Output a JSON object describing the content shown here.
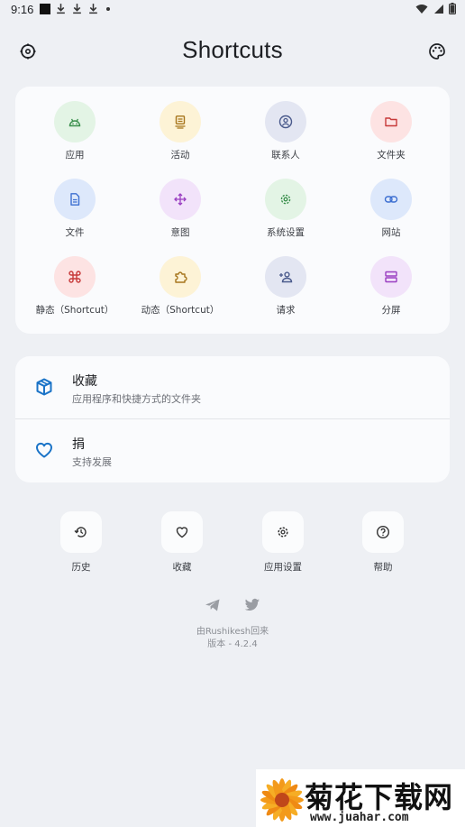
{
  "status_bar": {
    "time": "9:16"
  },
  "header": {
    "title": "Shortcuts"
  },
  "grid": [
    {
      "label": "应用",
      "icon": "android-icon",
      "bg": "#e3f4e5",
      "fg": "#3a8f4c"
    },
    {
      "label": "活动",
      "icon": "activity-icon",
      "bg": "#fdf3d6",
      "fg": "#a6741b"
    },
    {
      "label": "联系人",
      "icon": "contact-icon",
      "bg": "#e3e6f2",
      "fg": "#4a5a8c"
    },
    {
      "label": "文件夹",
      "icon": "folder-icon",
      "bg": "#fde3e3",
      "fg": "#c73a3a"
    },
    {
      "label": "文件",
      "icon": "file-icon",
      "bg": "#dde8fb",
      "fg": "#3d6fd1"
    },
    {
      "label": "意图",
      "icon": "intent-icon",
      "bg": "#f2e3fa",
      "fg": "#9a3ec1"
    },
    {
      "label": "系统设置",
      "icon": "settings-icon",
      "bg": "#e3f4e5",
      "fg": "#3a8f4c"
    },
    {
      "label": "网站",
      "icon": "link-icon",
      "bg": "#dde8fb",
      "fg": "#3d6fd1"
    },
    {
      "label": "静态（Shortcut）",
      "icon": "command-icon",
      "bg": "#fde3e3",
      "fg": "#c73a3a"
    },
    {
      "label": "动态（Shortcut）",
      "icon": "puzzle-icon",
      "bg": "#fdf3d6",
      "fg": "#a6741b"
    },
    {
      "label": "请求",
      "icon": "add-person-icon",
      "bg": "#e3e6f2",
      "fg": "#4a5a8c"
    },
    {
      "label": "分屏",
      "icon": "split-screen-icon",
      "bg": "#f2e3fa",
      "fg": "#9a3ec1"
    }
  ],
  "list": [
    {
      "title": "收藏",
      "subtitle": "应用程序和快捷方式的文件夹",
      "icon": "box-icon"
    },
    {
      "title": "捐",
      "subtitle": "支持发展",
      "icon": "heart-icon"
    }
  ],
  "quick": [
    {
      "label": "历史",
      "icon": "history-icon"
    },
    {
      "label": "收藏",
      "icon": "heart-icon"
    },
    {
      "label": "应用设置",
      "icon": "settings-icon"
    },
    {
      "label": "帮助",
      "icon": "help-icon"
    }
  ],
  "credit": {
    "line1": "由Rushikesh回来",
    "line2": "版本 - 4.2.4"
  },
  "watermark": {
    "title": "菊花下载网",
    "url": "www.juahar.com"
  },
  "colors": {
    "accent": "#1a73c7",
    "background": "#eef0f4",
    "card": "#fafbfd"
  }
}
